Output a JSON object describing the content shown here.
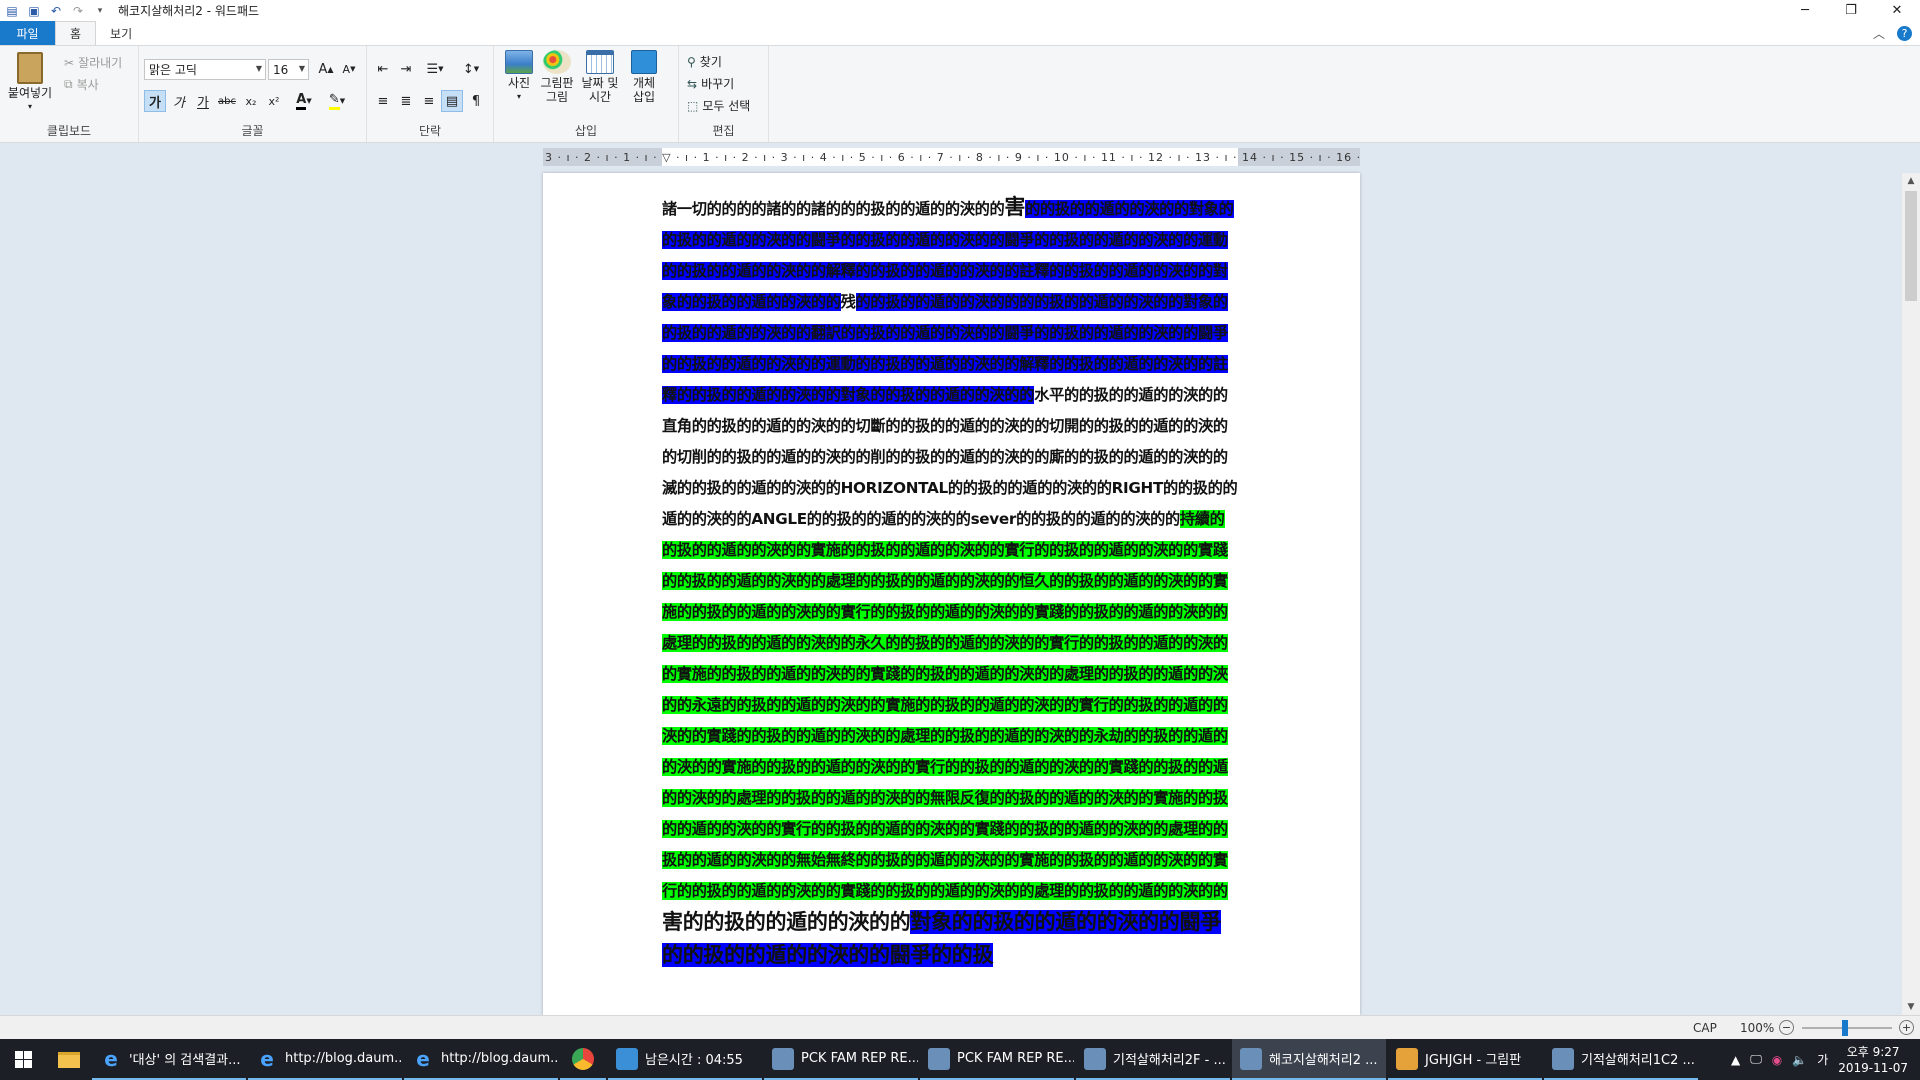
{
  "window": {
    "title": "해코지살해처리2 - 워드패드",
    "controls": [
      "─",
      "❐",
      "✕"
    ]
  },
  "tabs": {
    "file": "파일",
    "home": "홈",
    "view": "보기"
  },
  "ribbon": {
    "clipboard": {
      "label": "클립보드",
      "paste": "붙여넣기",
      "cut": "잘라내기",
      "copy": "복사"
    },
    "font": {
      "label": "글꼴",
      "family": "맑은 고딕",
      "size": "16",
      "bold": "가",
      "italic": "가",
      "underline": "가",
      "strike": "abc"
    },
    "paragraph": {
      "label": "단락"
    },
    "insert": {
      "label": "삽입",
      "picture": "사진",
      "paint": "그림판\n그림",
      "datetime": "날짜 및\n시간",
      "object": "개체\n삽입"
    },
    "editing": {
      "label": "편집",
      "find": "찾기",
      "replace": "바꾸기",
      "select_all": "모두 선택"
    }
  },
  "ruler": {
    "text": "3 · ı · 2 · ı · 1 · ı · ▽ · ı · 1 · ı · 2 · ı · 3 · ı · 4 · ı · 5 · ı · 6 · ı · 7 · ı · 8 · ı · 9 · ı · 10 · ı · 11 · ı · 12 · ı · 13 · ı · 14 · ı · 15 · ı · 16 · ı · 17 · ı · 18"
  },
  "document": {
    "segments": [
      {
        "text": "諸一切的的的的諸的的諸的的的扱的的遁的的浹的的",
        "hl": ""
      },
      {
        "text": "害",
        "hl": "",
        "big": true
      },
      {
        "text": "的的扱的的遁的的浹的的對象的的扱的的遁的的浹的的闘爭的的扱的的遁的的浹的的闘爭的的扱的的遁的的浹的的運動的的扱的的遁的的浹的的解釋的的扱的的遁的的浹的的註釋的的扱的的遁的的浹的的對象的的扱的的遁的的浹的的",
        "hl": "hb"
      },
      {
        "text": "残",
        "hl": "hw"
      },
      {
        "text": "的的扱的的遁的的浹的的的的扱的的遁的的浹的的對象的的扱的的遁的的浹的的翻訳的的扱的的遁的的浹的的闘爭的的扱的的遁的的浹的的闘爭的的扱的的遁的的浹的的運動的的扱的的遁的的浹的的解釋的的扱的的遁的的浹的的註釋的的扱的的遁的的浹的的對象的的扱的的遁的的浹的的",
        "hl": "hb"
      },
      {
        "text": "水平的的扱的的遁的的浹的的直角的的扱的的遁的的浹的的切斷的的扱的的遁的的浹的的切開的的扱的的遁的的浹的的切削的的扱的的遁的的浹的的削的的扱的的遁的的浹的的廝的的扱的的遁的的浹的的滅的的扱的的遁的的浹的的HORIZONTAL的的扱的的遁的的浹的的RIGHT的的扱的的遁的的浹的的ANGLE的的扱的的遁的的浹的的sever的的扱的的遁的的浹的的",
        "hl": ""
      },
      {
        "text": "持續的的扱的的遁的的浹的的實施的的扱的的遁的的浹的的實行的的扱的的遁的的浹的的實踐的的扱的的遁的的浹的的處理的的扱的的遁的的浹的的恒久的的扱的的遁的的浹的的實施的的扱的的遁的的浹的的實行的的扱的的遁的的浹的的實踐的的扱的的遁的的浹的的處理的的扱的的遁的的浹的的永久的的扱的的遁的的浹的的實行的的扱的的遁的的浹的的實施的的扱的的遁的的浹的的實踐的的扱的的遁的的浹的的處理的的扱的的遁的的浹的的永遠的的扱的的遁的的浹的的實施的的扱的的遁的的浹的的實行的的扱的的遁的的浹的的實踐的的扱的的遁的的浹的的處理的的扱的的遁的的浹的的永劫的的扱的的遁的的浹的的實施的的扱的的遁的的浹的的實行的的扱的的遁的的浹的的實踐的的扱的的遁的的浹的的處理的的扱的的遁的的浹的的無限反復的的扱的的遁的的浹的的實施的的扱的的遁的的浹的的實行的的扱的的遁的的浹的的實踐的的扱的的遁的的浹的的處理的的扱的的遁的的浹的的無始無終的的扱的的遁的的浹的的實施的的扱的的遁的的浹的的實行的的扱的的遁的的浹的的實踐的的扱的的遁的的浹的的處理的的扱的的遁的的浹的的",
        "hl": "hg"
      },
      {
        "text": "害的的扱的的遁的的浹的的",
        "hl": "hw",
        "big": true
      },
      {
        "text": "對象的的扱的的遁的的浹的的闘爭的的扱的的遁的的浹的的闘爭的的扱",
        "hl": "hb",
        "big": true
      }
    ]
  },
  "status": {
    "cap": "CAP",
    "zoom": "100%"
  },
  "taskbar": {
    "items": [
      {
        "label": "'대상' 의 검색결과...",
        "icon": "ie-icon",
        "color": "#1e90ff"
      },
      {
        "label": "http://blog.daum....",
        "icon": "ie-icon",
        "color": "#1e90ff"
      },
      {
        "label": "http://blog.daum....",
        "icon": "ie-icon",
        "color": "#1e90ff"
      },
      {
        "label": "",
        "icon": "chrome-icon",
        "color": "#e8453c"
      },
      {
        "label": "남은시간 : 04:55",
        "icon": "timer-icon",
        "color": "#3a8fd6"
      },
      {
        "label": "PCK FAM REP RE...",
        "icon": "wordpad-icon",
        "color": "#6a8fb8"
      },
      {
        "label": "PCK FAM REP RE...",
        "icon": "wordpad-icon",
        "color": "#6a8fb8"
      },
      {
        "label": "기적살해처리2F - ...",
        "icon": "wordpad-icon",
        "color": "#6a8fb8"
      },
      {
        "label": "해코지살해처리2 ...",
        "icon": "wordpad-icon",
        "color": "#6a8fb8",
        "active": true
      },
      {
        "label": "JGHJGH - 그림판",
        "icon": "paint-icon",
        "color": "#e5a23a"
      },
      {
        "label": "기적살해처리1C2 ...",
        "icon": "wordpad-icon",
        "color": "#6a8fb8"
      }
    ],
    "tray": {
      "lang": "가",
      "time": "오후 9:27",
      "date": "2019-11-07"
    }
  }
}
